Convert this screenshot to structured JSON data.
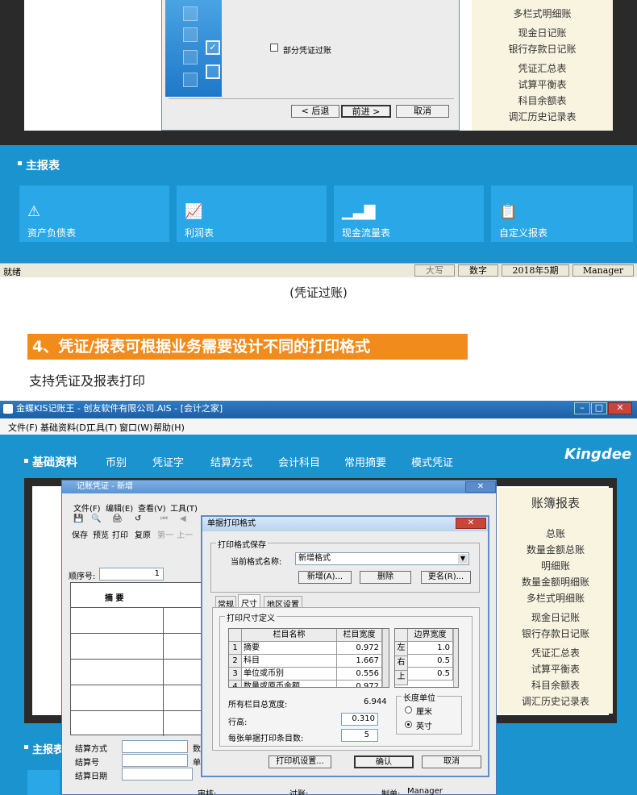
{
  "top": {
    "wizard": {
      "partial_post_label": "部分凭证过账",
      "back_button": "< 后退",
      "next_button": "前进 >",
      "cancel_button": "取消"
    },
    "ledger_items": [
      "多栏式明细账",
      "现金日记账",
      "银行存款日记账",
      "凭证汇总表",
      "试算平衡表",
      "科目余额表",
      "调汇历史记录表"
    ],
    "main_reports_title": "主报表",
    "report_tiles": [
      {
        "label": "资产负债表",
        "icon": "warning-triangle-icon"
      },
      {
        "label": "利润表",
        "icon": "line-chart-icon"
      },
      {
        "label": "现金流量表",
        "icon": "bar-chart-icon"
      },
      {
        "label": "自定义报表",
        "icon": "clipboard-icon"
      }
    ],
    "status": {
      "ready": "就绪",
      "caps": "大写",
      "num": "数字",
      "period": "2018年5期",
      "user": "Manager"
    }
  },
  "caption": "(凭证过账)",
  "banner": "4、凭证/报表可根据业务需要设计不同的打印格式",
  "subtitle": "支持凭证及报表打印",
  "bottom": {
    "window_title": "金蝶KIS记账王 - 创友软件有限公司.AIS - [会计之家]",
    "menu": [
      "文件(F)",
      "基础资料(D)",
      "工具(T)",
      "窗口(W)",
      "帮助(H)"
    ],
    "nav_section": "基础资料",
    "nav_items": [
      "币别",
      "凭证字",
      "结算方式",
      "会计科目",
      "常用摘要",
      "模式凭证"
    ],
    "brand": "Kingdee",
    "ledger_title": "账簿报表",
    "ledger_items": [
      "总账",
      "数量金额总账",
      "明细账",
      "数量金额明细账",
      "多栏式明细账",
      "现金日记账",
      "银行存款日记账",
      "凭证汇总表",
      "试算平衡表",
      "科目余额表",
      "调汇历史记录表"
    ],
    "main_reports_short": "主报表",
    "voucher": {
      "title": "记账凭证 - 新增",
      "menu": [
        "文件(F)",
        "编辑(E)",
        "查看(V)",
        "工具(T)"
      ],
      "tools": [
        "保存",
        "预览",
        "打印",
        "复原",
        "第一",
        "上一"
      ],
      "seq_label": "顺序号:",
      "seq_value": "1",
      "summary_header": "摘  要",
      "settle_method": "结算方式",
      "settle_no": "结算号",
      "settle_date": "结算日期",
      "num_short": "数",
      "unit_short": "单",
      "audit": "审核:",
      "post": "过账:",
      "maker": "制单:",
      "maker_value": "Manager"
    },
    "dialog": {
      "title": "单据打印格式",
      "save_group": "打印格式保存",
      "format_name_label": "当前格式名称:",
      "format_name_value": "新增格式",
      "new_button": "新增(A)...",
      "delete_button": "删除",
      "rename_button": "更名(R)...",
      "tabs": [
        "常规",
        "尺寸",
        "地区设置"
      ],
      "size_group": "打印尺寸定义",
      "col_name_header": "栏目名称",
      "col_width_header": "栏目宽度",
      "rows": [
        {
          "no": "1",
          "name": "摘要",
          "width": "0.972"
        },
        {
          "no": "2",
          "name": "科目",
          "width": "1.667"
        },
        {
          "no": "3",
          "name": "单位或币别",
          "width": "0.556"
        },
        {
          "no": "4",
          "name": "数量或原币金额",
          "width": "0.972"
        }
      ],
      "margin_header": "边界宽度",
      "margin_rows": [
        {
          "side": "左",
          "value": "1.0"
        },
        {
          "side": "右",
          "value": "0.5"
        },
        {
          "side": "上",
          "value": "0.5"
        }
      ],
      "total_width_label": "所有栏目总宽度:",
      "total_width_value": "6.944",
      "row_height_label": "行高:",
      "row_height_value": "0.310",
      "items_per_page_label": "每张单据打印条目数:",
      "items_per_page_value": "5",
      "unit_group": "长度单位",
      "unit_cm": "厘米",
      "unit_inch": "英寸",
      "printer_setup_button": "打印机设置...",
      "ok_button": "确认",
      "cancel_button": "取消"
    }
  }
}
